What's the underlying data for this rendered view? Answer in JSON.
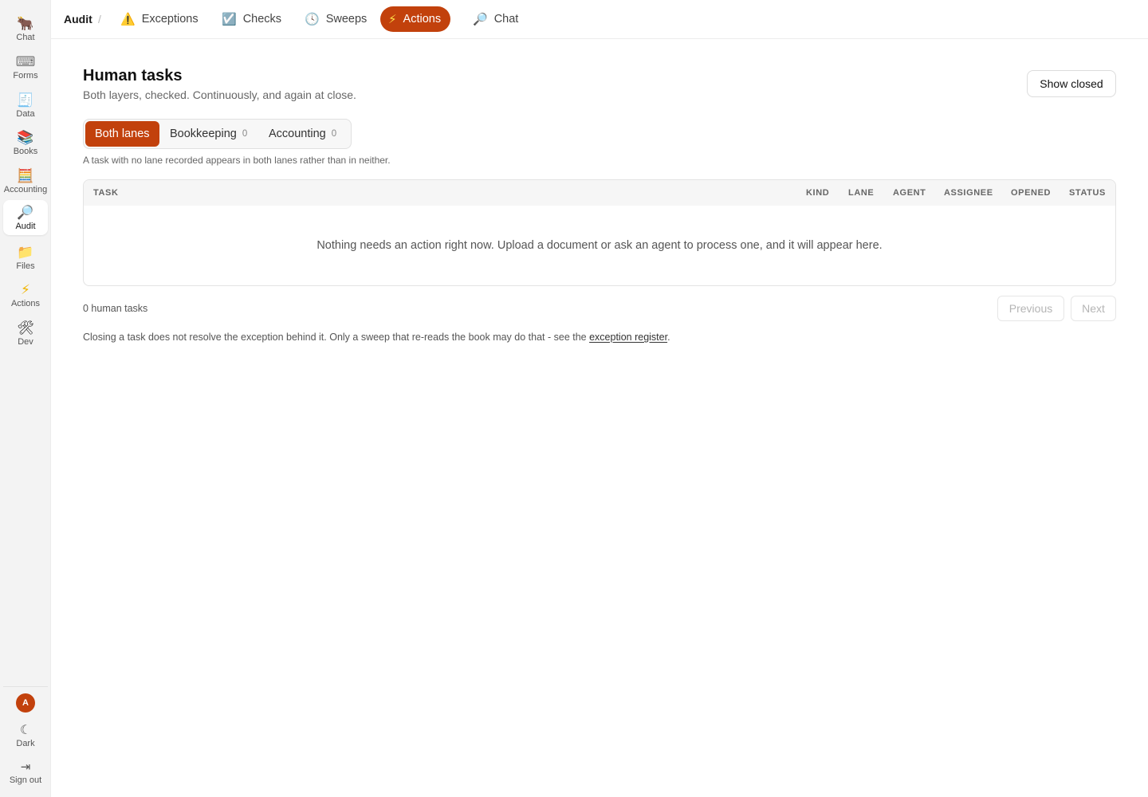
{
  "sidebar": {
    "items": [
      {
        "icon": "🐂",
        "label": "Chat",
        "name": "ox"
      },
      {
        "icon": "⌨",
        "label": "Forms",
        "name": "keyboard"
      },
      {
        "icon": "🧾",
        "label": "Data",
        "name": "receipt"
      },
      {
        "icon": "📚",
        "label": "Books",
        "name": "books"
      },
      {
        "icon": "🧮",
        "label": "Accounting",
        "name": "abacus"
      },
      {
        "icon": "🔎",
        "label": "Audit",
        "name": "magnifier"
      },
      {
        "icon": "📁",
        "label": "Files",
        "name": "folder"
      },
      {
        "icon": "⚡",
        "label": "Actions",
        "name": "lightning"
      },
      {
        "icon": "🛠",
        "label": "Dev",
        "name": "tools"
      }
    ],
    "active": "Audit",
    "avatar_initial": "A",
    "dark_label": "Dark",
    "dark_icon": "☾",
    "signout_label": "Sign out",
    "signout_icon": "⇥"
  },
  "topbar": {
    "breadcrumb": "Audit",
    "separator": "/",
    "tabs": [
      {
        "icon": "⚠️",
        "label": "Exceptions"
      },
      {
        "icon": "☑️",
        "label": "Checks"
      },
      {
        "icon": "🕓",
        "label": "Sweeps"
      },
      {
        "icon": "⚡",
        "label": "Actions"
      },
      {
        "icon": "🔎",
        "label": "Chat"
      }
    ],
    "active_tab": "Actions"
  },
  "page": {
    "title": "Human tasks",
    "subtitle": "Both layers, checked. Continuously, and again at close.",
    "show_closed_label": "Show closed"
  },
  "lanes": {
    "both_label": "Both lanes",
    "bookkeeping_label": "Bookkeeping",
    "bookkeeping_count": "0",
    "accounting_label": "Accounting",
    "accounting_count": "0",
    "hint": "A task with no lane recorded appears in both lanes rather than in neither."
  },
  "table": {
    "columns": [
      "TASK",
      "KIND",
      "LANE",
      "AGENT",
      "ASSIGNEE",
      "OPENED",
      "STATUS"
    ],
    "rows": [],
    "empty_message": "Nothing needs an action right now. Upload a document or ask an agent to process one, and it will appear here."
  },
  "footer": {
    "count_text": "0 human tasks",
    "previous_label": "Previous",
    "next_label": "Next",
    "note_prefix": "Closing a task does not resolve the exception behind it. Only a sweep that re-reads the book may do that - see the ",
    "note_link": "exception register",
    "note_suffix": "."
  },
  "colors": {
    "accent": "#c2410c",
    "sidebar_bg": "#f3f3f3",
    "border": "#e3e3e3"
  }
}
